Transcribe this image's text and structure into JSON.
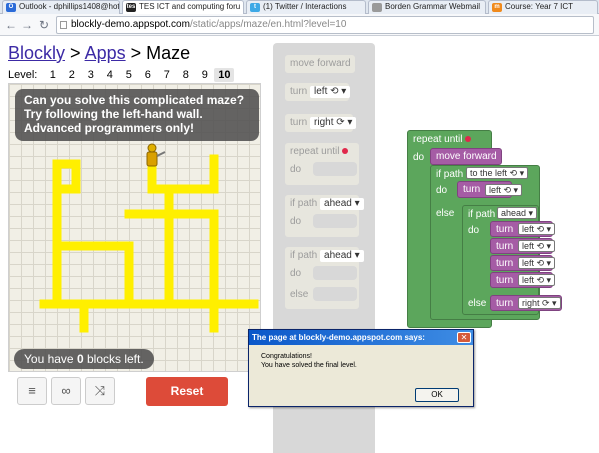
{
  "browser": {
    "tabs": [
      {
        "title": "Outlook - dphillips1408@hot",
        "favicon": "outlook-icon",
        "color": "#2b6bd8"
      },
      {
        "title": "TES ICT and computing foru",
        "favicon": "tes-icon",
        "color": "#222222"
      },
      {
        "title": "(1) Twitter / Interactions",
        "favicon": "twitter-icon",
        "color": "#3ea9e6"
      },
      {
        "title": "Borden Grammar Webmail",
        "favicon": "page-icon",
        "color": "#9a9a9a"
      },
      {
        "title": "Course: Year 7 ICT",
        "favicon": "moodle-icon",
        "color": "#f08a1c"
      }
    ],
    "url_host": "blockly-demo.appspot.com",
    "url_path": "/static/apps/maze/en.html?level=10"
  },
  "breadcrumb": {
    "blockly": "Blockly",
    "sep1": ">",
    "apps": "Apps",
    "sep2": ">",
    "page": "Maze"
  },
  "levels": {
    "label": "Level:",
    "items": [
      "1",
      "2",
      "3",
      "4",
      "5",
      "6",
      "7",
      "8",
      "9",
      "10"
    ],
    "current": "10"
  },
  "maze": {
    "bubble": "Can you solve this complicated maze? Try following the left-hand wall. Advanced programmers only!",
    "capacity_pre": "You have",
    "capacity_count": "0",
    "capacity_post": "blocks left.",
    "path_color": "#ffef00"
  },
  "controls": {
    "reset": "Reset",
    "icons": [
      "code-icon",
      "link-icon",
      "shuffle-icon"
    ]
  },
  "toolbox": {
    "move_forward": "move forward",
    "turn": "turn",
    "left": "left ⟲ ▾",
    "right": "right ⟳ ▾",
    "repeat_until": "repeat until",
    "do": "do",
    "if_path": "if path",
    "ahead": "ahead ▾",
    "else": "else"
  },
  "program": {
    "repeat_until": "repeat until",
    "do": "do",
    "move_forward": "move forward",
    "if_path": "if path",
    "to_the_left": "to the left ⟲ ▾",
    "ahead": "ahead ▾",
    "else": "else",
    "turn": "turn",
    "left": "left ⟲ ▾",
    "right": "right ⟳ ▾"
  },
  "dialog": {
    "title": "The page at blockly-demo.appspot.com says:",
    "line1": "Congratulations!",
    "line2": "You have solved the final level.",
    "ok": "OK",
    "close": "✕"
  }
}
